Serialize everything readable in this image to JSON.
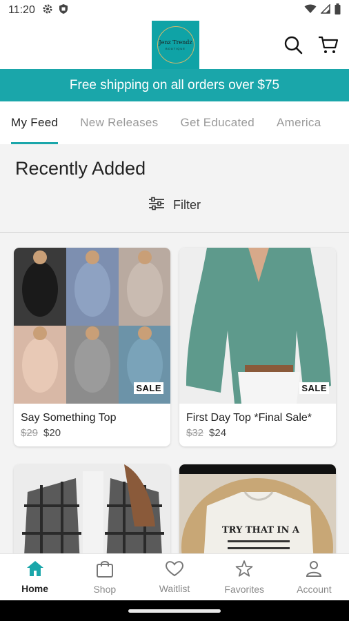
{
  "status_bar": {
    "time": "11:20"
  },
  "header": {
    "logo_text": "Jenz Trendz",
    "logo_subtext": "BOUTIQUE"
  },
  "banner": {
    "text": "Free shipping on all orders over $75"
  },
  "tabs": [
    {
      "label": "My Feed",
      "active": true
    },
    {
      "label": "New Releases",
      "active": false
    },
    {
      "label": "Get Educated",
      "active": false
    },
    {
      "label": "America",
      "active": false
    }
  ],
  "section": {
    "title": "Recently Added",
    "filter_label": "Filter"
  },
  "products": [
    {
      "name": "Say Something Top",
      "old_price": "$29",
      "price": "$20",
      "badge": "SALE"
    },
    {
      "name": "First Day Top *Final Sale*",
      "old_price": "$32",
      "price": "$24",
      "badge": "SALE"
    },
    {
      "shirt_text": "TRY THAT IN A"
    }
  ],
  "bottom_nav": [
    {
      "label": "Home",
      "icon": "home-icon",
      "active": true
    },
    {
      "label": "Shop",
      "icon": "shopping-bag-icon",
      "active": false
    },
    {
      "label": "Waitlist",
      "icon": "heart-icon",
      "active": false
    },
    {
      "label": "Favorites",
      "icon": "star-icon",
      "active": false
    },
    {
      "label": "Account",
      "icon": "person-icon",
      "active": false
    }
  ],
  "colors": {
    "brand_teal": "#1aa6aa"
  }
}
